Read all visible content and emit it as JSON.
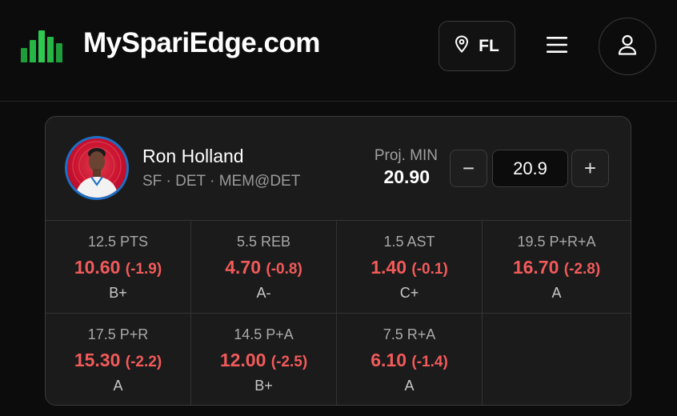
{
  "header": {
    "site_title": "MySpariEdge.com",
    "location_code": "FL",
    "logo_colors": [
      "#1f9d3a",
      "#27b545",
      "#2fc850",
      "#27b545",
      "#1f9d3a"
    ],
    "icons": [
      "bar-chart-logo-icon",
      "location-pin-icon",
      "hamburger-menu-icon",
      "user-icon"
    ]
  },
  "player": {
    "name": "Ron Holland",
    "meta": "SF · DET · MEM@DET",
    "proj_label": "Proj. MIN",
    "proj_value": "20.90",
    "min_input_value": "20.9",
    "decrement_label": "−",
    "increment_label": "+"
  },
  "props": [
    {
      "line": "12.5 PTS",
      "proj": "10.60",
      "diff": "(-1.9)",
      "grade": "B+"
    },
    {
      "line": "5.5 REB",
      "proj": "4.70",
      "diff": "(-0.8)",
      "grade": "A-"
    },
    {
      "line": "1.5 AST",
      "proj": "1.40",
      "diff": "(-0.1)",
      "grade": "C+"
    },
    {
      "line": "19.5 P+R+A",
      "proj": "16.70",
      "diff": "(-2.8)",
      "grade": "A"
    },
    {
      "line": "17.5 P+R",
      "proj": "15.30",
      "diff": "(-2.2)",
      "grade": "A"
    },
    {
      "line": "14.5 P+A",
      "proj": "12.00",
      "diff": "(-2.5)",
      "grade": "B+"
    },
    {
      "line": "7.5 R+A",
      "proj": "6.10",
      "diff": "(-1.4)",
      "grade": "A"
    }
  ],
  "colors": {
    "background": "#0c0c0c",
    "card": "#1b1b1b",
    "negative": "#f25a5a",
    "avatar_ring": "#1d6fc5",
    "team_red": "#c8102e"
  }
}
